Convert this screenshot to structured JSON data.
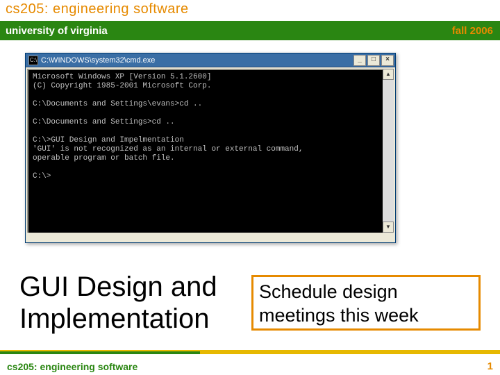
{
  "header": {
    "course": "cs205: engineering software",
    "university": "university of virginia",
    "term": "fall 2006"
  },
  "cmd": {
    "title": "C:\\WINDOWS\\system32\\cmd.exe",
    "icon_glyph": "C:\\",
    "min_label": "_",
    "max_label": "□",
    "close_label": "×",
    "lines": "Microsoft Windows XP [Version 5.1.2600]\n(C) Copyright 1985-2001 Microsoft Corp.\n\nC:\\Documents and Settings\\evans>cd ..\n\nC:\\Documents and Settings>cd ..\n\nC:\\>GUI Design and Impelmentation\n'GUI' is not recognized as an internal or external command,\noperable program or batch file.\n\nC:\\>"
  },
  "main_title_line1": "GUI Design and",
  "main_title_line2": "Implementation",
  "callout_line1": "Schedule design",
  "callout_line2": "meetings this week",
  "footer": {
    "left": "cs205: engineering software",
    "page": "1"
  }
}
